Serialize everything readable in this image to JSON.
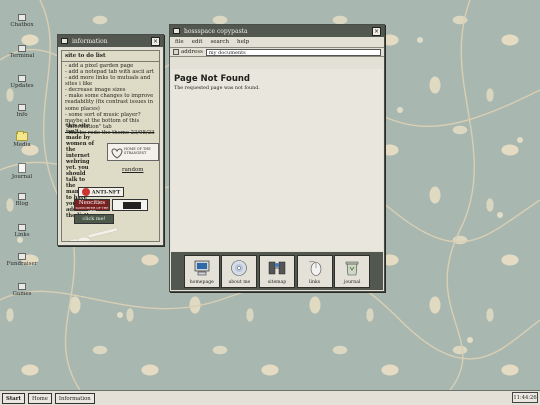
{
  "desktop": {
    "icons": [
      {
        "label": "Chatbox"
      },
      {
        "label": "Terminal"
      },
      {
        "label": "Updates"
      },
      {
        "label": "Info"
      },
      {
        "label": "Media"
      },
      {
        "label": "Journal"
      },
      {
        "label": "Blog"
      },
      {
        "label": "Links"
      },
      {
        "label": "Fundraiser"
      },
      {
        "label": "Games"
      }
    ]
  },
  "info_window": {
    "title": "information",
    "heading": "site to do list",
    "todo": [
      "- add a pixel garden page",
      "- add a notepad tab with ascii art",
      "- add more links to mutuals and sites i like",
      "- decrease image sizes",
      "- make some changes to improve readability (fix contrast issues in some places)",
      "- some sort of music player? maybe at the bottom of this \"information\" tab",
      "- maybe redo the theme 23/08/23"
    ],
    "note": "this site isn't made by women of the internet webring yet. you should talk to the manager to have your site added to the list!",
    "heart_badge_text": "HOME OF THE STRANGEST",
    "random_link": "random",
    "badges": {
      "stop": "ANTI-NFT",
      "neo": "Neocities",
      "neo_sub": "SUPPORTER OF THE ARTS",
      "click": "click me!"
    }
  },
  "main_window": {
    "title": "hossspace copypasta",
    "menu": [
      "file",
      "edit",
      "search",
      "help"
    ],
    "address_label": "address",
    "address_value": "my documents",
    "page_title": "Page Not Found",
    "page_text": "The requested page was not found.",
    "dock": [
      {
        "label": "homepage",
        "icon": "computer-icon"
      },
      {
        "label": "about me",
        "icon": "cd-icon"
      },
      {
        "label": "sitemap",
        "icon": "network-icon"
      },
      {
        "label": "links",
        "icon": "mouse-icon"
      },
      {
        "label": "journal",
        "icon": "recycle-bin-icon"
      }
    ]
  },
  "taskbar": {
    "start": "Start",
    "tabs": [
      "Home",
      "Information"
    ],
    "clock": "11:44:26"
  },
  "colors": {
    "titlebar": "#52574f",
    "window": "#e3e0d6",
    "wallpaper": "#a9b7b1"
  }
}
